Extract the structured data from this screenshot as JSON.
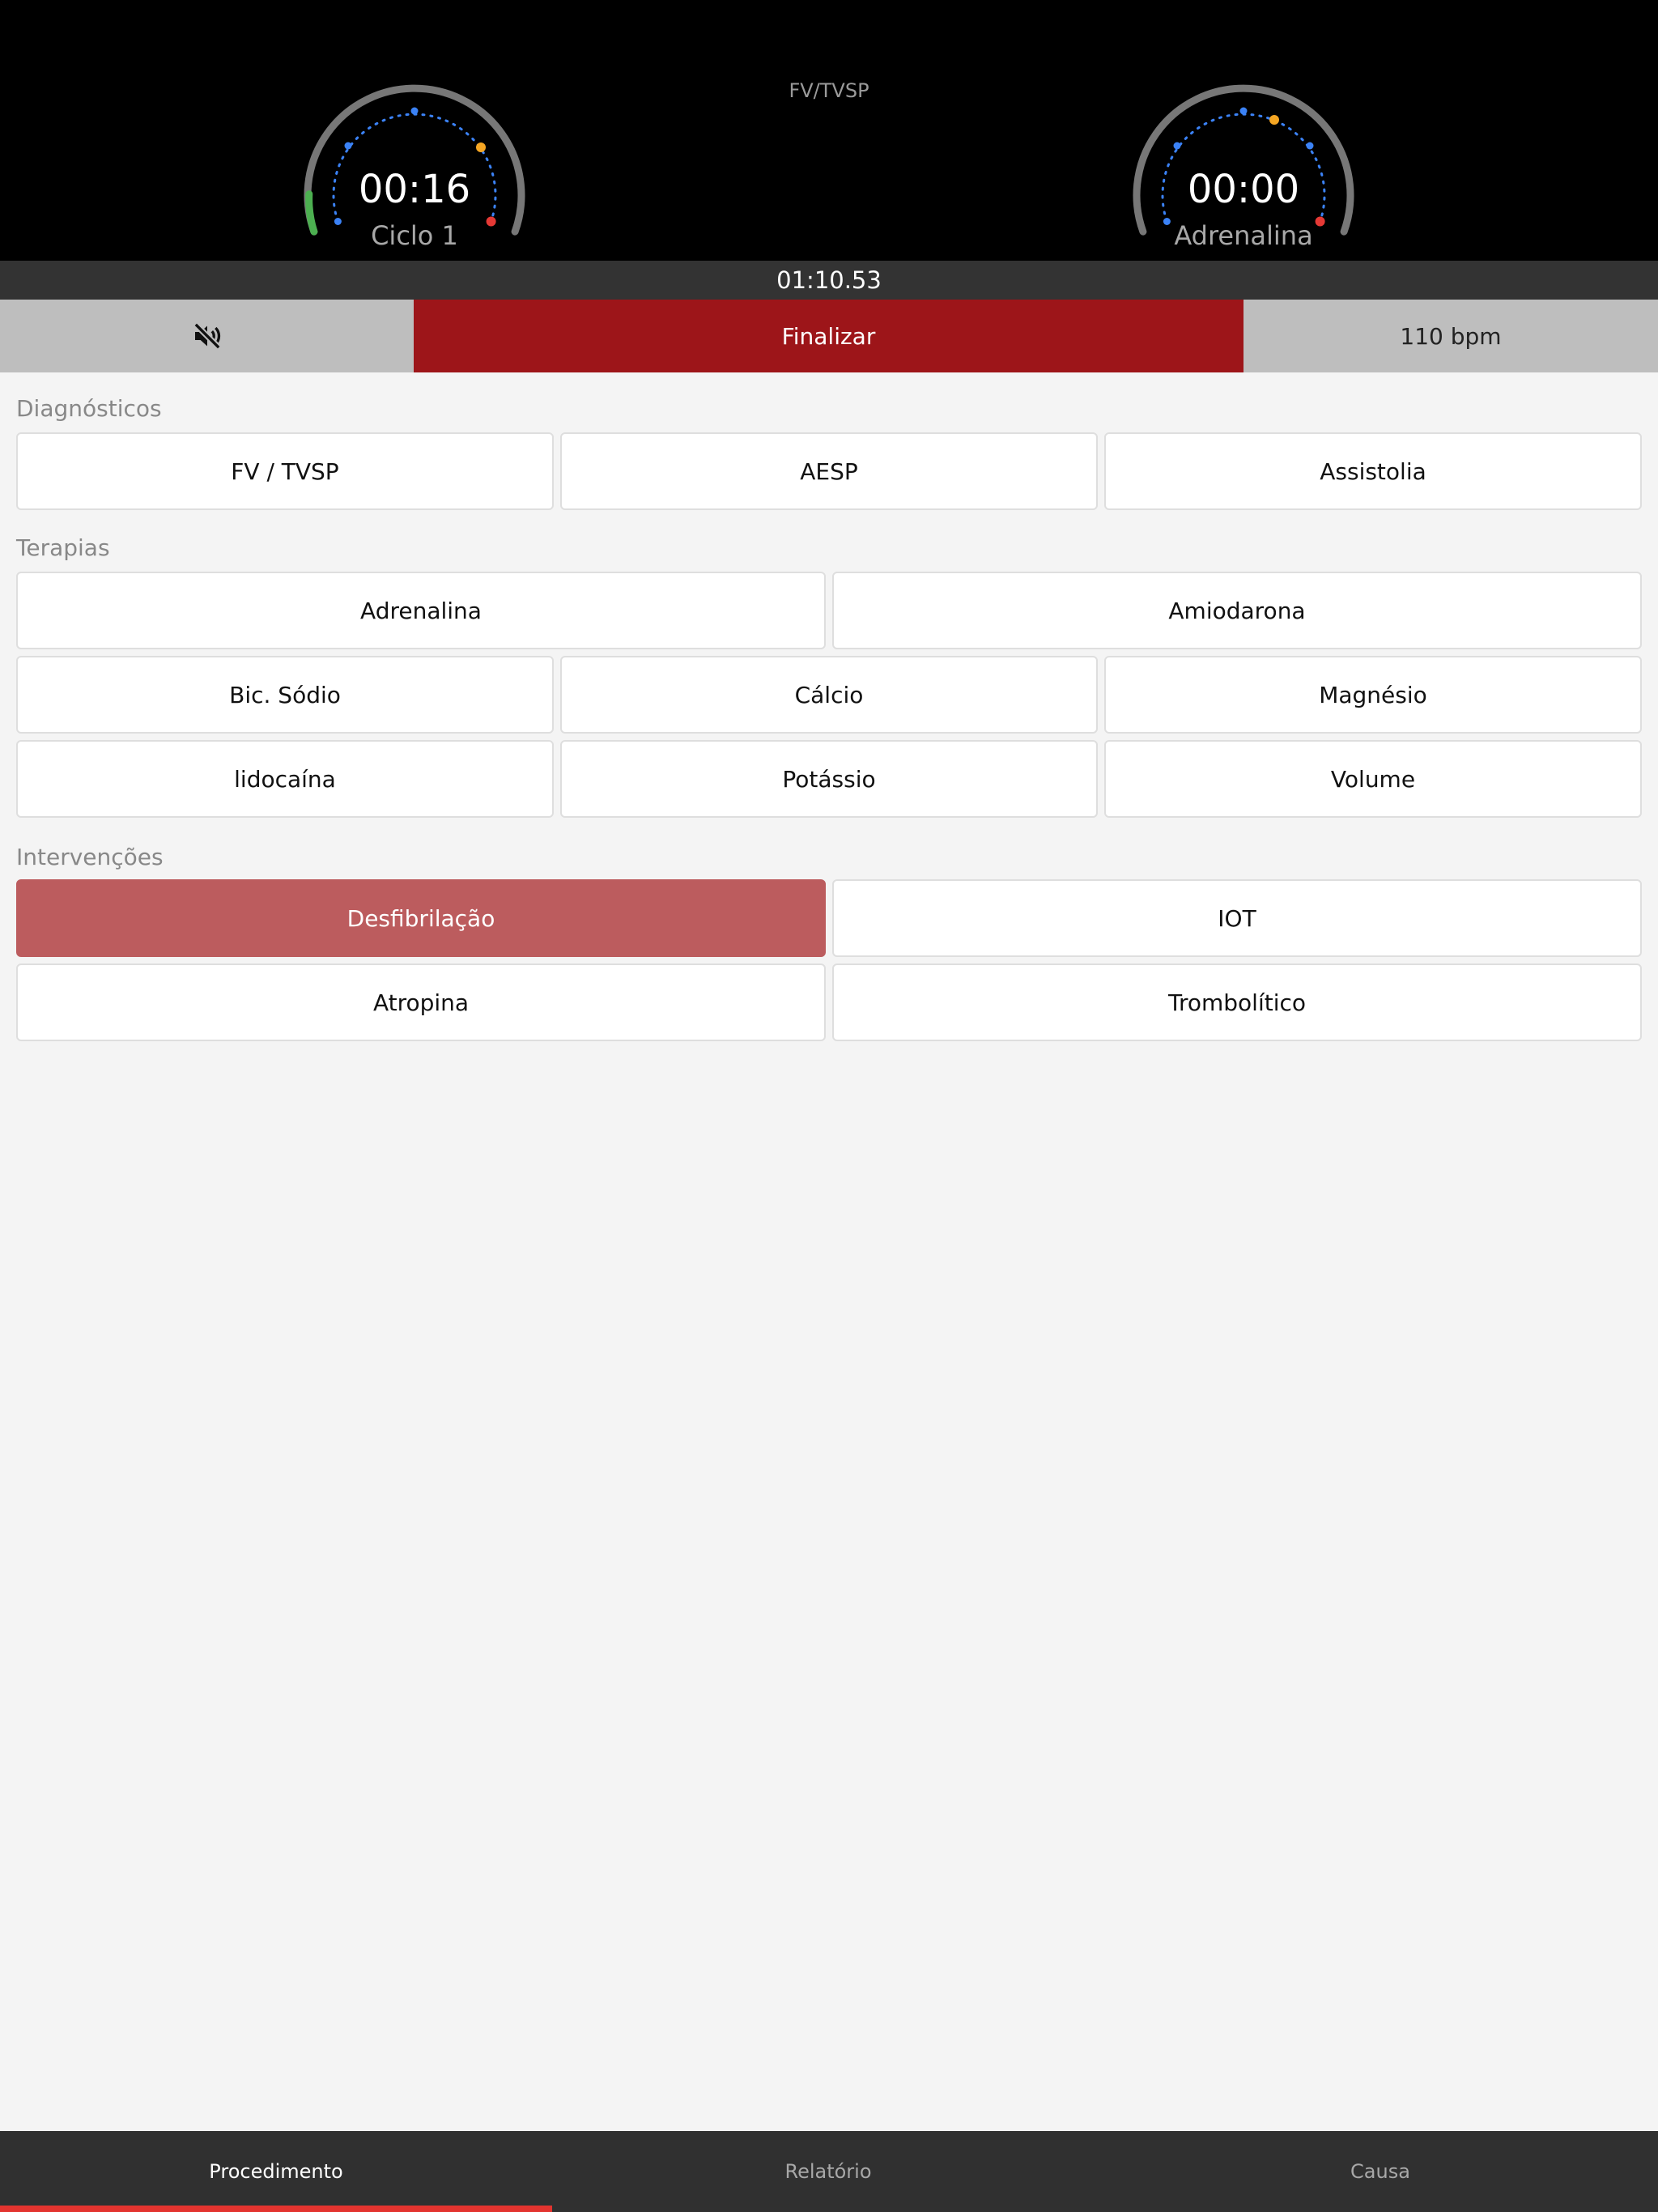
{
  "header": {
    "rhythm": "FV/TVSP",
    "elapsed": "01:10.53",
    "cycle_timer": {
      "time": "00:16",
      "label": "Ciclo 1"
    },
    "adrenaline_timer": {
      "time": "00:00",
      "label": "Adrenalina"
    }
  },
  "actions": {
    "mute_icon": "speaker-muted-icon",
    "finalizar": "Finalizar",
    "heart_rate": "110 bpm"
  },
  "sections": {
    "diagnosticos": {
      "label": "Diagnósticos",
      "items": [
        "FV / TVSP",
        "AESP",
        "Assistolia"
      ]
    },
    "terapias": {
      "label": "Terapias",
      "items": [
        "Adrenalina",
        "Amiodarona",
        "Bic. Sódio",
        "Cálcio",
        "Magnésio",
        "lidocaína",
        "Potássio",
        "Volume"
      ]
    },
    "intervencoes": {
      "label": "Intervenções",
      "items": [
        "Desfibrilação",
        "IOT",
        "Atropina",
        "Trombolítico"
      ],
      "active_item": "Desfibrilação"
    }
  },
  "tabs": {
    "items": [
      "Procedimento",
      "Relatório",
      "Causa"
    ],
    "selected": "Procedimento"
  },
  "colors": {
    "finalize_red": "#9d1519",
    "active_intervention": "#bc5c5e",
    "progress_green": "#4caf50",
    "marker_orange": "#f5a623",
    "marker_red": "#e53935",
    "marker_blue": "#3b82f6"
  }
}
